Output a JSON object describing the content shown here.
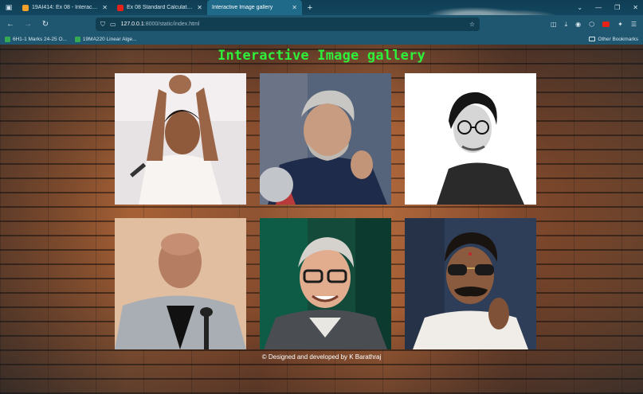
{
  "browser": {
    "tabs": [
      {
        "title": "19AI414: Ex 08 - Interactive Im",
        "icon": "moodle-icon",
        "active": false
      },
      {
        "title": "Ex 08 Standard Calculator Des",
        "icon": "youtube-icon",
        "active": false
      },
      {
        "title": "Interactive Image gallery",
        "icon": "",
        "active": true
      }
    ],
    "url_host": "127.0.0.1",
    "url_path": ":8000/static/index.html",
    "bookmarks": [
      {
        "label": "6H1-1 Marks 24-25 O..."
      },
      {
        "label": "19MA220 Linear Alge..."
      }
    ],
    "other_bookmarks": "Other Bookmarks"
  },
  "page": {
    "title": "Interactive Image gallery",
    "footer": "© Designed and developed by K Barathraj",
    "photos": [
      {
        "name": "photo-1",
        "desc": "man in white shirt with hands raised"
      },
      {
        "name": "photo-2",
        "desc": "grey-haired man smiling"
      },
      {
        "name": "photo-3",
        "desc": "man with glasses black and white"
      },
      {
        "name": "photo-4",
        "desc": "bald man in grey blazer"
      },
      {
        "name": "photo-5",
        "desc": "man with glasses in sweater"
      },
      {
        "name": "photo-6",
        "desc": "man with sunglasses and moustache"
      }
    ]
  },
  "colors": {
    "title_green": "#2ef03a",
    "chrome": "#1f5670"
  }
}
